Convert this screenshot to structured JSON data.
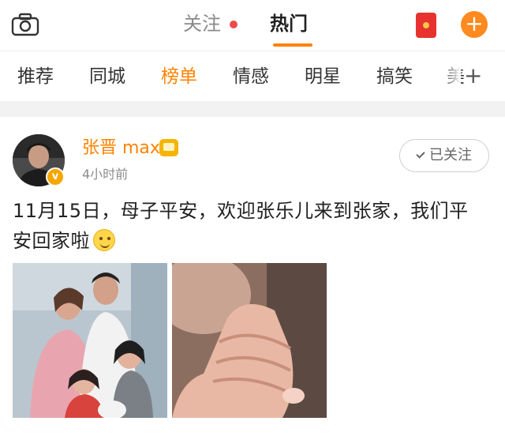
{
  "topbar": {
    "tabs": [
      {
        "label": "关注",
        "has_dot": true
      },
      {
        "label": "热门",
        "active": true
      }
    ],
    "icons": [
      "camera-icon",
      "red-packet-icon",
      "plus-icon"
    ],
    "accent_color": "#ff8200"
  },
  "channels": {
    "items": [
      "推荐",
      "同城",
      "榜单",
      "情感",
      "明星",
      "搞笑",
      "美"
    ],
    "active": "榜单",
    "more_icon": "+"
  },
  "post": {
    "author": "张晋 max",
    "time": "4小时前",
    "follow_label": "已关注",
    "text": "11月15日，母子平安，欢迎张乐儿来到张家，我们平安回家啦",
    "images": [
      "family-photo",
      "baby-hand-photo"
    ]
  }
}
